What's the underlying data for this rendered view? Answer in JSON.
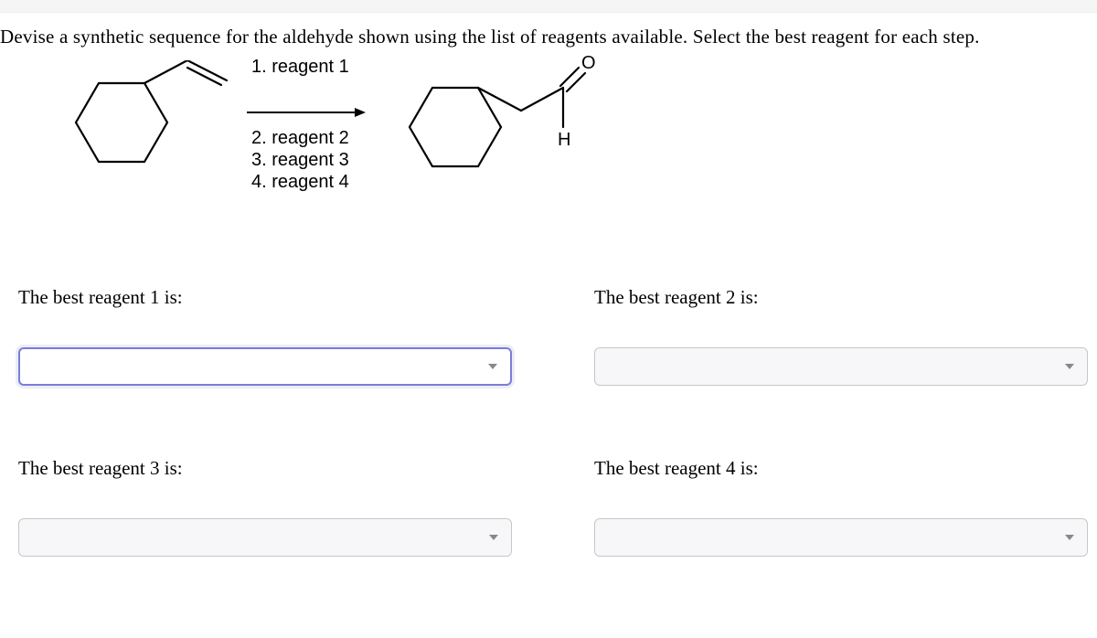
{
  "question": "Devise a synthetic sequence for the aldehyde shown using the list of reagents available. Select the best reagent for each step.",
  "scheme": {
    "step1": "1. reagent 1",
    "step2": "2. reagent 2",
    "step3": "3. reagent 3",
    "step4": "4. reagent 4",
    "oxygen_label": "O",
    "hydrogen_label": "H"
  },
  "prompts": {
    "r1": "The best reagent 1 is:",
    "r2": "The best reagent 2 is:",
    "r3": "The best reagent 3 is:",
    "r4": "The best reagent 4 is:"
  }
}
